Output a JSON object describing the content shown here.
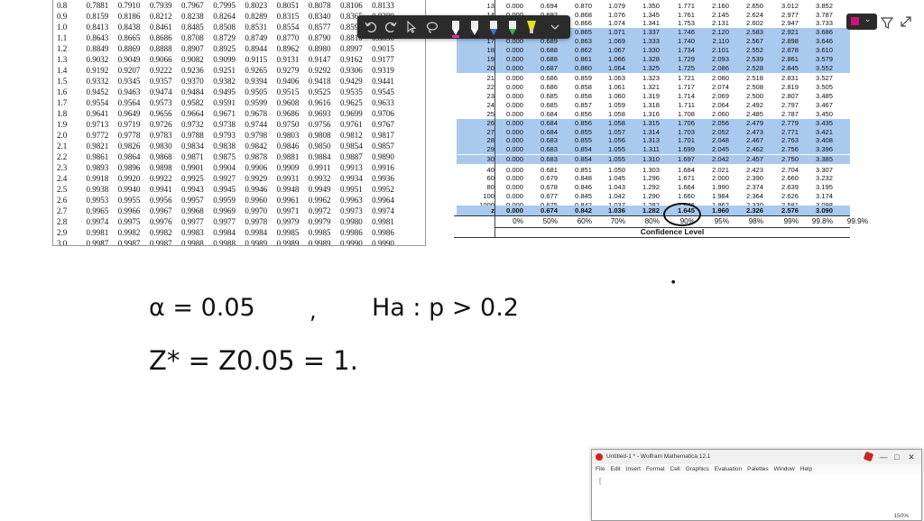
{
  "z_table": {
    "rows": [
      {
        "z": "0.8",
        "v": [
          "0.7881",
          "0.7910",
          "0.7939",
          "0.7967",
          "0.7995",
          "0.8023",
          "0.8051",
          "0.8078",
          "0.8106",
          "0.8133"
        ]
      },
      {
        "z": "0.9",
        "v": [
          "0.8159",
          "0.8186",
          "0.8212",
          "0.8238",
          "0.8264",
          "0.8289",
          "0.8315",
          "0.8340",
          "0.8365",
          "0.8389"
        ]
      },
      {
        "z": "1.0",
        "v": [
          "0.8413",
          "0.8438",
          "0.8461",
          "0.8485",
          "0.8508",
          "0.8531",
          "0.8554",
          "0.8577",
          "0.8599",
          "0.8621"
        ]
      },
      {
        "z": "1.1",
        "v": [
          "0.8643",
          "0.8665",
          "0.8686",
          "0.8708",
          "0.8729",
          "0.8749",
          "0.8770",
          "0.8790",
          "0.8810",
          "0.8830"
        ]
      },
      {
        "z": "1.2",
        "v": [
          "0.8849",
          "0.8869",
          "0.8888",
          "0.8907",
          "0.8925",
          "0.8944",
          "0.8962",
          "0.8980",
          "0.8997",
          "0.9015"
        ]
      },
      {
        "z": "1.3",
        "v": [
          "0.9032",
          "0.9049",
          "0.9066",
          "0.9082",
          "0.9099",
          "0.9115",
          "0.9131",
          "0.9147",
          "0.9162",
          "0.9177"
        ]
      },
      {
        "z": "1.4",
        "v": [
          "0.9192",
          "0.9207",
          "0.9222",
          "0.9236",
          "0.9251",
          "0.9265",
          "0.9279",
          "0.9292",
          "0.9306",
          "0.9319"
        ]
      },
      {
        "z": "1.5",
        "v": [
          "0.9332",
          "0.9345",
          "0.9357",
          "0.9370",
          "0.9382",
          "0.9394",
          "0.9406",
          "0.9418",
          "0.9429",
          "0.9441"
        ]
      },
      {
        "z": "1.6",
        "v": [
          "0.9452",
          "0.9463",
          "0.9474",
          "0.9484",
          "0.9495",
          "0.9505",
          "0.9515",
          "0.9525",
          "0.9535",
          "0.9545"
        ]
      },
      {
        "z": "1.7",
        "v": [
          "0.9554",
          "0.9564",
          "0.9573",
          "0.9582",
          "0.9591",
          "0.9599",
          "0.9608",
          "0.9616",
          "0.9625",
          "0.9633"
        ]
      },
      {
        "z": "1.8",
        "v": [
          "0.9641",
          "0.9649",
          "0.9656",
          "0.9664",
          "0.9671",
          "0.9678",
          "0.9686",
          "0.9693",
          "0.9699",
          "0.9706"
        ]
      },
      {
        "z": "1.9",
        "v": [
          "0.9713",
          "0.9719",
          "0.9726",
          "0.9732",
          "0.9738",
          "0.9744",
          "0.9750",
          "0.9756",
          "0.9761",
          "0.9767"
        ]
      },
      {
        "z": "2.0",
        "v": [
          "0.9772",
          "0.9778",
          "0.9783",
          "0.9788",
          "0.9793",
          "0.9798",
          "0.9803",
          "0.9808",
          "0.9812",
          "0.9817"
        ]
      },
      {
        "z": "2.1",
        "v": [
          "0.9821",
          "0.9826",
          "0.9830",
          "0.9834",
          "0.9838",
          "0.9842",
          "0.9846",
          "0.9850",
          "0.9854",
          "0.9857"
        ]
      },
      {
        "z": "2.2",
        "v": [
          "0.9861",
          "0.9864",
          "0.9868",
          "0.9871",
          "0.9875",
          "0.9878",
          "0.9881",
          "0.9884",
          "0.9887",
          "0.9890"
        ]
      },
      {
        "z": "2.3",
        "v": [
          "0.9893",
          "0.9896",
          "0.9898",
          "0.9901",
          "0.9904",
          "0.9906",
          "0.9909",
          "0.9911",
          "0.9913",
          "0.9916"
        ]
      },
      {
        "z": "2.4",
        "v": [
          "0.9918",
          "0.9920",
          "0.9922",
          "0.9925",
          "0.9927",
          "0.9929",
          "0.9931",
          "0.9932",
          "0.9934",
          "0.9936"
        ]
      },
      {
        "z": "2.5",
        "v": [
          "0.9938",
          "0.9940",
          "0.9941",
          "0.9943",
          "0.9945",
          "0.9946",
          "0.9948",
          "0.9949",
          "0.9951",
          "0.9952"
        ]
      },
      {
        "z": "2.6",
        "v": [
          "0.9953",
          "0.9955",
          "0.9956",
          "0.9957",
          "0.9959",
          "0.9960",
          "0.9961",
          "0.9962",
          "0.9963",
          "0.9964"
        ]
      },
      {
        "z": "2.7",
        "v": [
          "0.9965",
          "0.9966",
          "0.9967",
          "0.9968",
          "0.9969",
          "0.9970",
          "0.9971",
          "0.9972",
          "0.9973",
          "0.9974"
        ]
      },
      {
        "z": "2.8",
        "v": [
          "0.9974",
          "0.9975",
          "0.9976",
          "0.9977",
          "0.9977",
          "0.9978",
          "0.9979",
          "0.9979",
          "0.9980",
          "0.9981"
        ]
      },
      {
        "z": "2.9",
        "v": [
          "0.9981",
          "0.9982",
          "0.9982",
          "0.9983",
          "0.9984",
          "0.9984",
          "0.9985",
          "0.9985",
          "0.9986",
          "0.9986"
        ]
      },
      {
        "z": "3.0",
        "v": [
          "0.9987",
          "0.9987",
          "0.9987",
          "0.9988",
          "0.9988",
          "0.9989",
          "0.9989",
          "0.9989",
          "0.9990",
          "0.9990"
        ]
      }
    ]
  },
  "t_table": {
    "rows": [
      {
        "df": "13",
        "v": [
          "0.000",
          "0.694",
          "0.870",
          "1.079",
          "1.350",
          "1.771",
          "2.160",
          "2.650",
          "3.012",
          "3.852",
          "4.221"
        ],
        "hl": false
      },
      {
        "df": "14",
        "v": [
          "0.000",
          "0.692",
          "0.868",
          "1.076",
          "1.345",
          "1.761",
          "2.145",
          "2.624",
          "2.977",
          "3.787",
          "4.140"
        ],
        "hl": false
      },
      {
        "df": "15",
        "v": [
          "0.000",
          "0.691",
          "0.866",
          "1.074",
          "1.341",
          "1.753",
          "2.131",
          "2.602",
          "2.947",
          "3.733",
          "4.073"
        ],
        "hl": false
      },
      {
        "df": "16",
        "v": [
          "0.000",
          "0.690",
          "0.865",
          "1.071",
          "1.337",
          "1.746",
          "2.120",
          "2.583",
          "2.921",
          "3.686",
          "4.015"
        ],
        "hl": true
      },
      {
        "df": "17",
        "v": [
          "0.000",
          "0.689",
          "0.863",
          "1.069",
          "1.333",
          "1.740",
          "2.110",
          "2.567",
          "2.898",
          "3.646",
          "3.965"
        ],
        "hl": true
      },
      {
        "df": "18",
        "v": [
          "0.000",
          "0.688",
          "0.862",
          "1.067",
          "1.330",
          "1.734",
          "2.101",
          "2.552",
          "2.878",
          "3.610",
          "3.922"
        ],
        "hl": true
      },
      {
        "df": "19",
        "v": [
          "0.000",
          "0.688",
          "0.861",
          "1.066",
          "1.328",
          "1.729",
          "2.093",
          "2.539",
          "2.861",
          "3.579",
          "3.883"
        ],
        "hl": true
      },
      {
        "df": "20",
        "v": [
          "0.000",
          "0.687",
          "0.860",
          "1.064",
          "1.325",
          "1.725",
          "2.086",
          "2.528",
          "2.845",
          "3.552",
          "3.850"
        ],
        "hl": true
      },
      {
        "df": "21",
        "v": [
          "0.000",
          "0.686",
          "0.859",
          "1.063",
          "1.323",
          "1.721",
          "2.080",
          "2.518",
          "2.831",
          "3.527",
          "3.819"
        ],
        "hl": false
      },
      {
        "df": "22",
        "v": [
          "0.000",
          "0.686",
          "0.858",
          "1.061",
          "1.321",
          "1.717",
          "2.074",
          "2.508",
          "2.819",
          "3.505",
          "3.792"
        ],
        "hl": false
      },
      {
        "df": "23",
        "v": [
          "0.000",
          "0.685",
          "0.858",
          "1.060",
          "1.319",
          "1.714",
          "2.069",
          "2.500",
          "2.807",
          "3.485",
          "3.768"
        ],
        "hl": false
      },
      {
        "df": "24",
        "v": [
          "0.000",
          "0.685",
          "0.857",
          "1.059",
          "1.318",
          "1.711",
          "2.064",
          "2.492",
          "2.797",
          "3.467",
          "3.745"
        ],
        "hl": false
      },
      {
        "df": "25",
        "v": [
          "0.000",
          "0.684",
          "0.856",
          "1.058",
          "1.316",
          "1.708",
          "2.060",
          "2.485",
          "2.787",
          "3.450",
          "3.725"
        ],
        "hl": false
      },
      {
        "df": "26",
        "v": [
          "0.000",
          "0.684",
          "0.856",
          "1.058",
          "1.315",
          "1.706",
          "2.056",
          "2.479",
          "2.779",
          "3.435",
          "3.707"
        ],
        "hl": true
      },
      {
        "df": "27",
        "v": [
          "0.000",
          "0.684",
          "0.855",
          "1.057",
          "1.314",
          "1.703",
          "2.052",
          "2.473",
          "2.771",
          "3.421",
          "3.690"
        ],
        "hl": true
      },
      {
        "df": "28",
        "v": [
          "0.000",
          "0.683",
          "0.855",
          "1.056",
          "1.313",
          "1.701",
          "2.048",
          "2.467",
          "2.763",
          "3.408",
          "3.674"
        ],
        "hl": true
      },
      {
        "df": "29",
        "v": [
          "0.000",
          "0.683",
          "0.854",
          "1.055",
          "1.311",
          "1.699",
          "2.045",
          "2.462",
          "2.756",
          "3.396",
          "3.659"
        ],
        "hl": true
      },
      {
        "df": "30",
        "v": [
          "0.000",
          "0.683",
          "0.854",
          "1.055",
          "1.310",
          "1.697",
          "2.042",
          "2.457",
          "2.750",
          "3.385",
          "3.646"
        ],
        "hl": true
      },
      {
        "df": "40",
        "v": [
          "0.000",
          "0.681",
          "0.851",
          "1.050",
          "1.303",
          "1.684",
          "2.021",
          "2.423",
          "2.704",
          "3.307",
          "3.551"
        ],
        "hl": false
      },
      {
        "df": "60",
        "v": [
          "0.000",
          "0.679",
          "0.848",
          "1.045",
          "1.296",
          "1.671",
          "2.000",
          "2.390",
          "2.660",
          "3.232",
          "3.460"
        ],
        "hl": false
      },
      {
        "df": "80",
        "v": [
          "0.000",
          "0.678",
          "0.846",
          "1.043",
          "1.292",
          "1.664",
          "1.990",
          "2.374",
          "2.639",
          "3.195",
          "3.416"
        ],
        "hl": false
      },
      {
        "df": "100",
        "v": [
          "0.000",
          "0.677",
          "0.845",
          "1.042",
          "1.290",
          "1.660",
          "1.984",
          "2.364",
          "2.626",
          "3.174",
          "3.390"
        ],
        "hl": false
      },
      {
        "df": "1000",
        "v": [
          "0.000",
          "0.675",
          "0.842",
          "1.037",
          "1.282",
          "1.646",
          "1.962",
          "2.330",
          "2.581",
          "3.098",
          "3.300"
        ],
        "hl": false
      },
      {
        "df": "z",
        "v": [
          "0.000",
          "0.674",
          "0.842",
          "1.036",
          "1.282",
          "1.645",
          "1.960",
          "2.326",
          "2.576",
          "3.090",
          "3.291"
        ],
        "hl": true
      }
    ],
    "confidence_levels": [
      "0%",
      "50%",
      "60%",
      "70%",
      "80%",
      "90%",
      "95%",
      "98%",
      "99%",
      "99.8%",
      "99.9%"
    ],
    "confidence_label": "Confidence Level"
  },
  "handwriting": {
    "alpha_line": "α = 0.05",
    "comma": ",",
    "ha_line": "Ha : p > 0.2",
    "z_line": "Z* = Z0.05 = 1."
  },
  "toolbar": {
    "tools": [
      "undo-icon",
      "redo-icon",
      "pointer-icon",
      "lasso-icon",
      "pen-icon",
      "pen-icon",
      "pen-icon",
      "pen-icon",
      "highlighter-icon",
      "more-icon"
    ],
    "pen_colors": [
      "#e03090",
      "#222222",
      "#3a78d8",
      "#3db04a",
      "#e8e020"
    ],
    "active_color": "#d4107c"
  },
  "mathematica": {
    "title": "Untitled-1 * - Wolfram Mathematica 12.1",
    "menu": [
      "File",
      "Edit",
      "Insert",
      "Format",
      "Cell",
      "Graphics",
      "Evaluation",
      "Palettes",
      "Window",
      "Help"
    ],
    "cell_bracket": "[ ",
    "zoom": "150%",
    "min": "—",
    "max": "□",
    "close": "✕"
  }
}
